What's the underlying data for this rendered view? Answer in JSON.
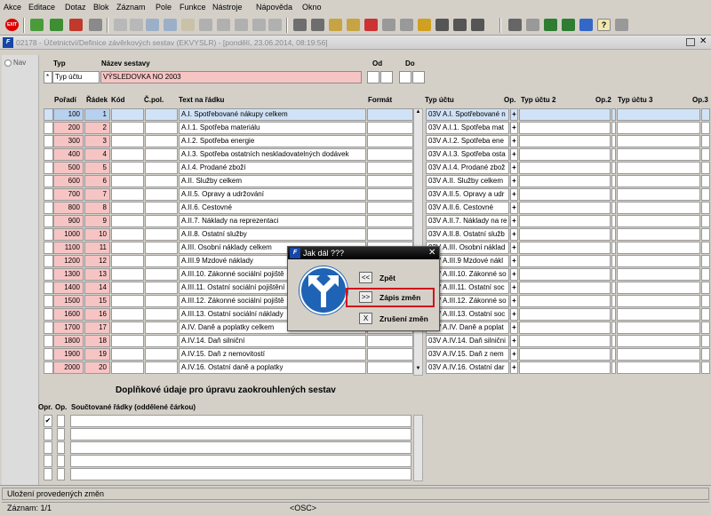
{
  "menu": [
    "Akce",
    "Editace",
    "Dotaz",
    "Blok",
    "Záznam",
    "Pole",
    "Funkce",
    "Nástroje",
    "Nápověda",
    "Okno"
  ],
  "toolbar": {
    "exit_label": "EXIT"
  },
  "window": {
    "title": "02178 - Účetnictví/Definice závěrkových sestav (EKVYSLR) - [pondělí, 23.06.2014, 08:19:56]"
  },
  "nav": {
    "label": "Nav"
  },
  "header": {
    "typ_label": "Typ",
    "nazev_label": "Název sestavy",
    "od_label": "Od",
    "do_label": "Do",
    "typ_flag": "*",
    "typ_value": "Typ účtu",
    "nazev_value": "VÝSLEDOVKA NO 2003"
  },
  "table": {
    "columns": {
      "poradi": "Pořadí",
      "radek": "Řádek",
      "kod": "Kód",
      "cpol": "Č.pol.",
      "text": "Text na řádku",
      "formule": "Formát",
      "typ_uctu": "Typ účtu",
      "op": "Op.",
      "typ_uctu2": "Typ účtu 2",
      "op2": "Op.2",
      "typ_uctu3": "Typ účtu 3",
      "op3": "Op.3"
    },
    "rows": [
      {
        "poradi": "100",
        "radek": "1",
        "text": "A.I. Spotřebované nákupy celkem",
        "typ": "03V A.I. Spotřebované n",
        "op": "+"
      },
      {
        "poradi": "200",
        "radek": "2",
        "text": "A.I.1. Spotřeba materiálu",
        "typ": "03V A.I.1. Spotřeba mat",
        "op": "+"
      },
      {
        "poradi": "300",
        "radek": "3",
        "text": "A.I.2. Spotřeba energie",
        "typ": "03V A.I.2. Spotřeba ene",
        "op": "+"
      },
      {
        "poradi": "400",
        "radek": "4",
        "text": "A.I.3. Spotřeba ostatních neskladovatelných dodávek",
        "typ": "03V A.I.3. Spotřeba osta",
        "op": "+"
      },
      {
        "poradi": "500",
        "radek": "5",
        "text": "A.I.4. Prodané zboží",
        "typ": "03V A.I.4. Prodané zbož",
        "op": "+"
      },
      {
        "poradi": "600",
        "radek": "6",
        "text": "A.II. Služby celkem",
        "typ": "03V A.II. Služby celkem",
        "op": "+"
      },
      {
        "poradi": "700",
        "radek": "7",
        "text": "A.II.5. Opravy a udržování",
        "typ": "03V A.II.5. Opravy a udr",
        "op": "+"
      },
      {
        "poradi": "800",
        "radek": "8",
        "text": "A.II.6. Cestovné",
        "typ": "03V A.II.6. Cestovné",
        "op": "+"
      },
      {
        "poradi": "900",
        "radek": "9",
        "text": "A.II.7. Náklady na reprezentaci",
        "typ": "03V A.II.7. Náklady na re",
        "op": "+"
      },
      {
        "poradi": "1000",
        "radek": "10",
        "text": "A.II.8. Ostatní služby",
        "typ": "03V A.II.8. Ostatní služb",
        "op": "+"
      },
      {
        "poradi": "1100",
        "radek": "11",
        "text": "A.III. Osobní náklady celkem",
        "typ": "03V A.III. Osobní náklad",
        "op": "+"
      },
      {
        "poradi": "1200",
        "radek": "12",
        "text": "A.III.9 Mzdové náklady",
        "typ": "03V A.III.9 Mzdové nákl",
        "op": "+"
      },
      {
        "poradi": "1300",
        "radek": "13",
        "text": "A.III.10. Zákonné sociální pojiště",
        "typ": "03V A.III.10. Zákonné so",
        "op": "+"
      },
      {
        "poradi": "1400",
        "radek": "14",
        "text": "A.III.11. Ostatní sociální pojištění",
        "typ": "03V A.III.11. Ostatní soc",
        "op": "+"
      },
      {
        "poradi": "1500",
        "radek": "15",
        "text": "A.III.12. Zákonné sociální pojiště",
        "typ": "03V A.III.12. Zákonné so",
        "op": "+"
      },
      {
        "poradi": "1600",
        "radek": "16",
        "text": "A.III.13. Ostatní sociální náklady",
        "typ": "03V A.III.13. Ostatní soc",
        "op": "+"
      },
      {
        "poradi": "1700",
        "radek": "17",
        "text": "A.IV. Daně a poplatky celkem",
        "typ": "03V A.IV. Daně a poplat",
        "op": "+"
      },
      {
        "poradi": "1800",
        "radek": "18",
        "text": "A.IV.14. Daň silniční",
        "typ": "03V A.IV.14. Daň silnični",
        "op": "+"
      },
      {
        "poradi": "1900",
        "radek": "19",
        "text": "A.IV.15. Daň z nemovitostí",
        "typ": "03V A.IV.15. Daň z nem",
        "op": "+"
      },
      {
        "poradi": "2000",
        "radek": "20",
        "text": "A.IV.16. Ostatní daně a poplatky",
        "typ": "03V A.IV.16. Ostatní dar",
        "op": "+"
      }
    ]
  },
  "extra": {
    "title": "Doplňkové údaje pro úpravu zaokrouhlených sestav",
    "col_opr": "Opr.",
    "col_op": "Op.",
    "col_rows": "Součtované řádky (oddělené čárkou)",
    "checked": "✔"
  },
  "dialog": {
    "title": "Jak dál ???",
    "back_btn": "<<",
    "back_label": "Zpět",
    "save_btn": ">>",
    "save_label": "Zápis změn",
    "cancel_btn": "X",
    "cancel_label": "Zrušení změn",
    "close": "✕"
  },
  "status": {
    "message": "Uložení provedených změn",
    "record": "Záznam: 1/1",
    "osc": "<OSC>"
  },
  "colors": {
    "highlight": "#d0141c",
    "pink": "#f7c4c4",
    "selected": "#cfe2f7"
  }
}
